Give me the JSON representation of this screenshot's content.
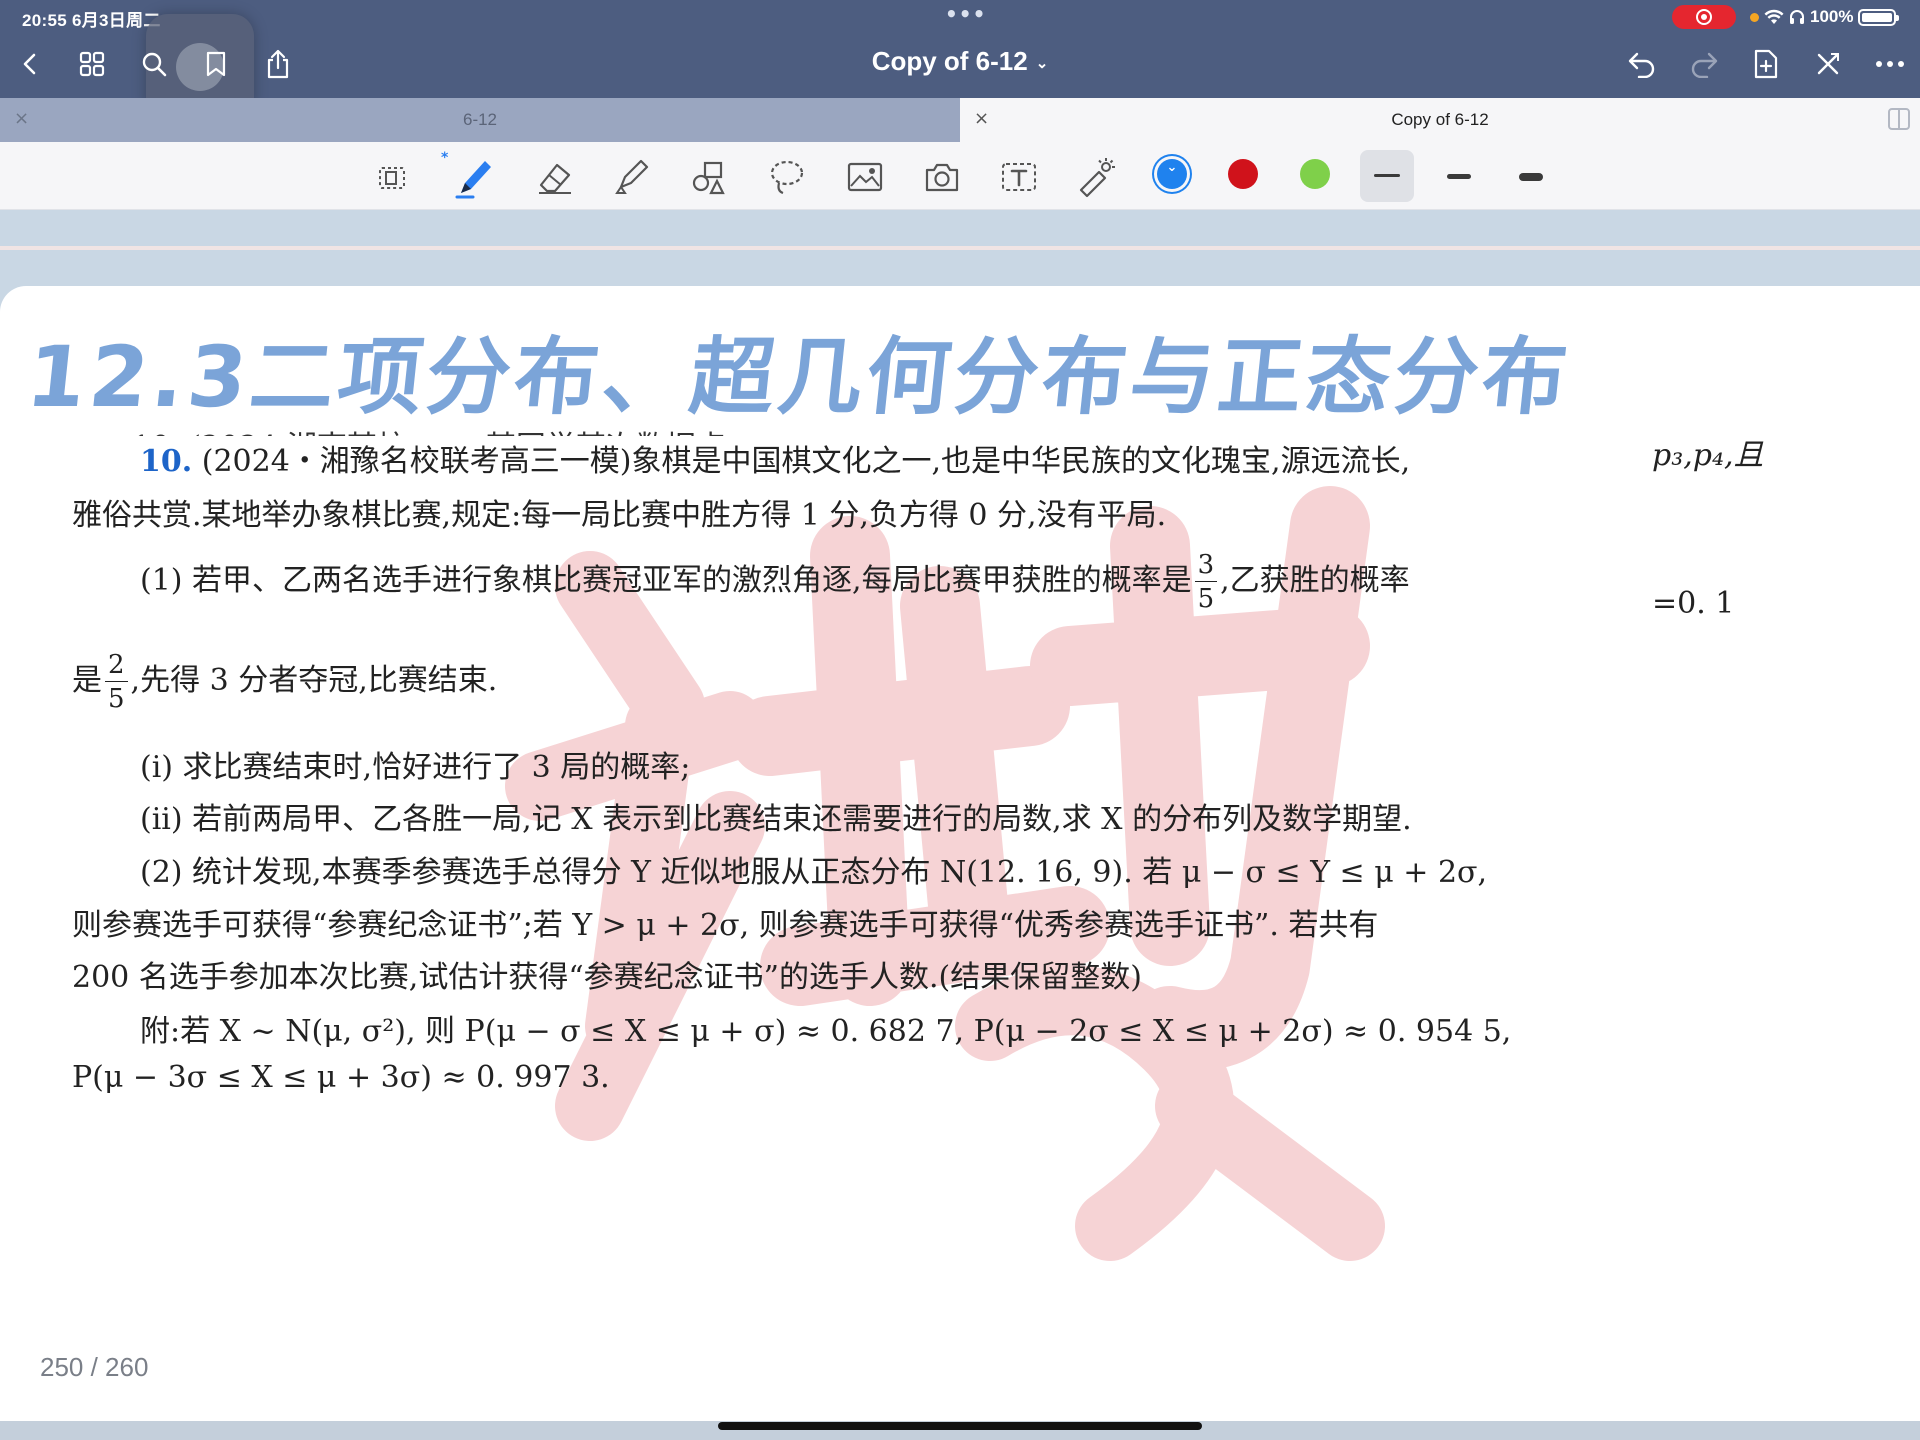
{
  "status": {
    "time_date": "20:55  6月3日周二",
    "dots": "•••",
    "battery": "100%"
  },
  "nav": {
    "doc_title": "Copy of 6-12",
    "title_chevron": "⌄"
  },
  "tabs": [
    {
      "label": "6-12",
      "active": false
    },
    {
      "label": "Copy of 6-12",
      "active": true
    }
  ],
  "tab_close_glyph": "×",
  "toolbar": {
    "tools": [
      "lasso-select-icon",
      "pen-icon",
      "eraser-icon",
      "highlighter-icon",
      "shapes-icon",
      "lasso-icon",
      "image-icon",
      "camera-icon",
      "text-icon",
      "laser-pointer-icon"
    ],
    "colors": [
      "#1f82ee",
      "#d0121b",
      "#7fd04a"
    ],
    "bluetooth_glyph": "*"
  },
  "document": {
    "headline": "12.3二项分布、超几何分布与正态分布",
    "cut_line": "10. (2024·湖南某校 …… 某同学某次数据点 ……",
    "q_number": "10.",
    "q_line1": "(2024・湘豫名校联考高三一模)象棋是中国棋文化之一,也是中华民族的文化瑰宝,源远流长,",
    "q_line1_edge": "p₃,p₄,且",
    "q_line2": "雅俗共赏.某地举办象棋比赛,规定:每一局比赛中胜方得 1 分,负方得 0 分,没有平局.",
    "part1_a": "(1) 若甲、乙两名选手进行象棋比赛冠亚军的激烈角逐,每局比赛甲获胜的概率是",
    "frac1_num": "3",
    "frac1_den": "5",
    "part1_b": ",乙获胜的概率",
    "edge_value": "=0. 1",
    "part1_c": "是",
    "frac2_num": "2",
    "frac2_den": "5",
    "part1_d": ",先得 3 分者夺冠,比赛结束.",
    "sub_i": "(i) 求比赛结束时,恰好进行了 3 局的概率;",
    "sub_ii": "(ii) 若前两局甲、乙各胜一局,记 X 表示到比赛结束还需要进行的局数,求 X 的分布列及数学期望.",
    "part2_a": "(2) 统计发现,本赛季参赛选手总得分 Y 近似地服从正态分布 N(12. 16, 9). 若 μ − σ ≤ Y ≤ μ + 2σ,",
    "part2_b": "则参赛选手可获得“参赛纪念证书”;若 Y > μ + 2σ, 则参赛选手可获得“优秀参赛选手证书”. 若共有",
    "part2_c": "200 名选手参加本次比赛,试估计获得“参赛纪念证书”的选手人数.(结果保留整数)",
    "appendix_a": "附:若 X ~ N(μ, σ²), 则 P(μ − σ ≤ X ≤ μ + σ) ≈ 0. 682 7, P(μ − 2σ ≤ X ≤ μ + 2σ) ≈ 0. 954 5,",
    "appendix_b": "P(μ − 3σ ≤ X ≤ μ + 3σ) ≈ 0. 997 3."
  },
  "page_indicator": "250 / 260"
}
